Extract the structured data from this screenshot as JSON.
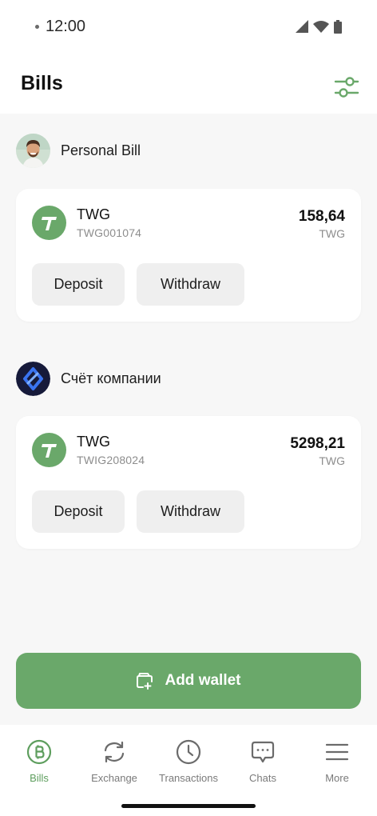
{
  "status_bar": {
    "time": "12:00"
  },
  "header": {
    "title": "Bills"
  },
  "bills": [
    {
      "name": "Personal Bill",
      "account": {
        "currency": "TWG",
        "account_id": "TWG001074",
        "balance": "158,64",
        "balance_currency": "TWG",
        "deposit_label": "Deposit",
        "withdraw_label": "Withdraw"
      }
    },
    {
      "name": "Счёт компании",
      "account": {
        "currency": "TWG",
        "account_id": "TWIG208024",
        "balance": "5298,21",
        "balance_currency": "TWG",
        "deposit_label": "Deposit",
        "withdraw_label": "Withdraw"
      }
    }
  ],
  "add_wallet_label": "Add wallet",
  "tabs": [
    {
      "label": "Bills",
      "icon": "bitcoin-icon",
      "active": true
    },
    {
      "label": "Exchange",
      "icon": "exchange-icon",
      "active": false
    },
    {
      "label": "Transactions",
      "icon": "clock-icon",
      "active": false
    },
    {
      "label": "Chats",
      "icon": "chat-icon",
      "active": false
    },
    {
      "label": "More",
      "icon": "menu-icon",
      "active": false
    }
  ],
  "colors": {
    "accent": "#6aa86a",
    "active_tab": "#5e9e5e",
    "company_logo_bg": "#161a3a",
    "company_logo_fg": "#3a74f0"
  }
}
